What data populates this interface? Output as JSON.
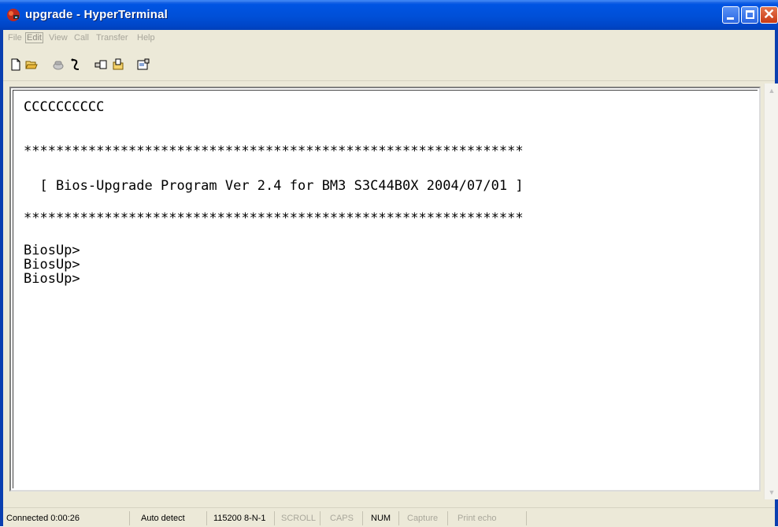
{
  "window": {
    "title": "upgrade - HyperTerminal"
  },
  "menu": {
    "items": [
      "File",
      "Edit",
      "View",
      "Call",
      "Transfer",
      "Help"
    ]
  },
  "toolbar": {
    "icons": [
      "new-icon",
      "open-icon",
      "connect-icon",
      "disconnect-icon",
      "send-icon",
      "receive-icon",
      "properties-icon"
    ]
  },
  "terminal": {
    "lines": [
      "CCCCCCCCCC",
      "",
      "**************************************************************",
      "",
      "  [ Bios-Upgrade Program Ver 2.4 for BM3 S3C44B0X 2004/07/01 ]",
      "",
      "**************************************************************",
      "",
      "BiosUp>",
      "BiosUp>",
      "BiosUp>"
    ]
  },
  "status": {
    "connected": "Connected 0:00:26",
    "detect": "Auto detect",
    "baud": "115200 8-N-1",
    "scroll": "SCROLL",
    "caps": "CAPS",
    "num": "NUM",
    "capture": "Capture",
    "print": "Print echo"
  },
  "colors": {
    "title_bar": "#0054e3",
    "close_button": "#c93a14",
    "terminal_bg": "#ffffff"
  }
}
